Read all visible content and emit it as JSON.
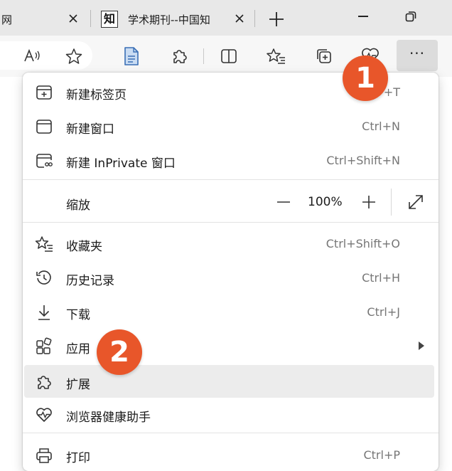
{
  "tabs": [
    {
      "title": "网",
      "active": false
    },
    {
      "title": "学术期刊--中国知",
      "favicon_char": "知",
      "active": true
    }
  ],
  "toolbar": {
    "icons": [
      "read-aloud-icon",
      "favorite-star-icon",
      "document-icon",
      "extensions-icon",
      "split-screen-icon",
      "favorites-list-icon",
      "collections-icon",
      "browser-essentials-icon",
      "more-icon"
    ]
  },
  "menu": {
    "items": [
      {
        "label": "新建标签页",
        "shortcut": "+T",
        "icon": "new-tab-icon"
      },
      {
        "label": "新建窗口",
        "shortcut": "Ctrl+N",
        "icon": "new-window-icon"
      },
      {
        "label": "新建 InPrivate 窗口",
        "shortcut": "Ctrl+Shift+N",
        "icon": "inprivate-icon"
      },
      {
        "label": "收藏夹",
        "shortcut": "Ctrl+Shift+O",
        "icon": "favorites-icon"
      },
      {
        "label": "历史记录",
        "shortcut": "Ctrl+H",
        "icon": "history-icon"
      },
      {
        "label": "下载",
        "shortcut": "Ctrl+J",
        "icon": "download-icon"
      },
      {
        "label": "应用",
        "shortcut": "",
        "icon": "apps-icon",
        "has_submenu": true
      },
      {
        "label": "扩展",
        "shortcut": "",
        "icon": "extensions-icon",
        "hovered": true
      },
      {
        "label": "浏览器健康助手",
        "shortcut": "",
        "icon": "health-icon"
      },
      {
        "label": "打印",
        "shortcut": "Ctrl+P",
        "icon": "print-icon"
      }
    ],
    "zoom": {
      "label": "缩放",
      "value": "100%"
    }
  },
  "badges": {
    "step1": "1",
    "step2": "2"
  },
  "colors": {
    "badge": "#e8562a",
    "tabstrip": "#e8e8e8",
    "toolbar": "#f7f7f7",
    "hover": "#ececec"
  }
}
